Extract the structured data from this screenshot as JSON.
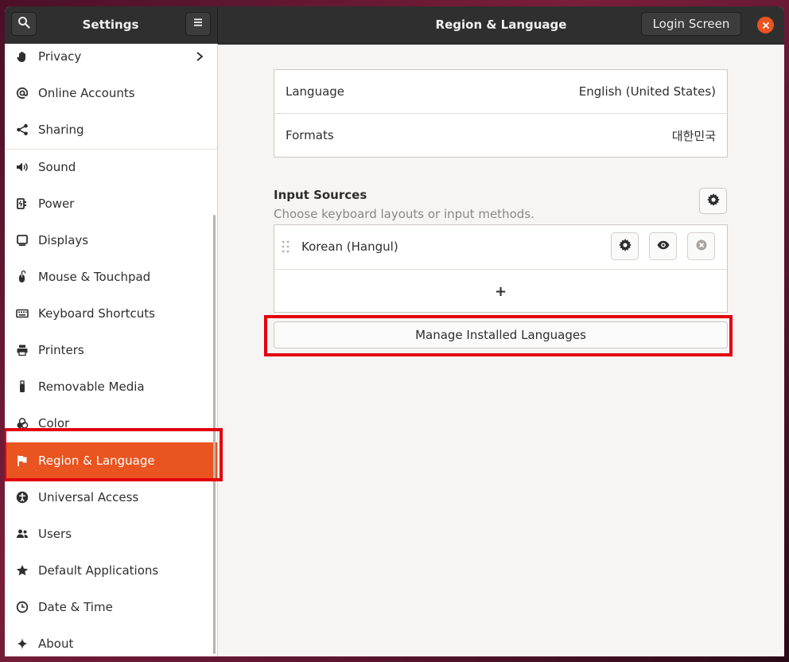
{
  "titlebar": {
    "sidebar_title": "Settings",
    "main_title": "Region & Language",
    "login_screen_label": "Login Screen"
  },
  "sidebar": {
    "items": [
      {
        "label": "Privacy",
        "icon": "hand-icon"
      },
      {
        "label": "Online Accounts",
        "icon": "at-sign-icon"
      },
      {
        "label": "Sharing",
        "icon": "share-icon"
      },
      {
        "label": "Sound",
        "icon": "speaker-icon"
      },
      {
        "label": "Power",
        "icon": "power-plug-icon"
      },
      {
        "label": "Displays",
        "icon": "display-icon"
      },
      {
        "label": "Mouse & Touchpad",
        "icon": "mouse-icon"
      },
      {
        "label": "Keyboard Shortcuts",
        "icon": "keyboard-icon"
      },
      {
        "label": "Printers",
        "icon": "printer-icon"
      },
      {
        "label": "Removable Media",
        "icon": "usb-drive-icon"
      },
      {
        "label": "Color",
        "icon": "color-circles-icon"
      },
      {
        "label": "Region & Language",
        "icon": "flag-icon",
        "active": true
      },
      {
        "label": "Universal Access",
        "icon": "accessibility-icon"
      },
      {
        "label": "Users",
        "icon": "users-icon"
      },
      {
        "label": "Default Applications",
        "icon": "star-icon"
      },
      {
        "label": "Date & Time",
        "icon": "clock-icon"
      },
      {
        "label": "About",
        "icon": "sparkle-icon"
      }
    ]
  },
  "main": {
    "language_label": "Language",
    "language_value": "English (United States)",
    "formats_label": "Formats",
    "formats_value": "대한민국",
    "input_sources_title": "Input Sources",
    "input_sources_subtitle": "Choose keyboard layouts or input methods.",
    "input_source_name": "Korean (Hangul)",
    "add_symbol": "+",
    "manage_languages_label": "Manage Installed Languages"
  },
  "colors": {
    "accent": "#e95420",
    "highlight": "#e2000f",
    "titlebar": "#2f2f2f"
  }
}
